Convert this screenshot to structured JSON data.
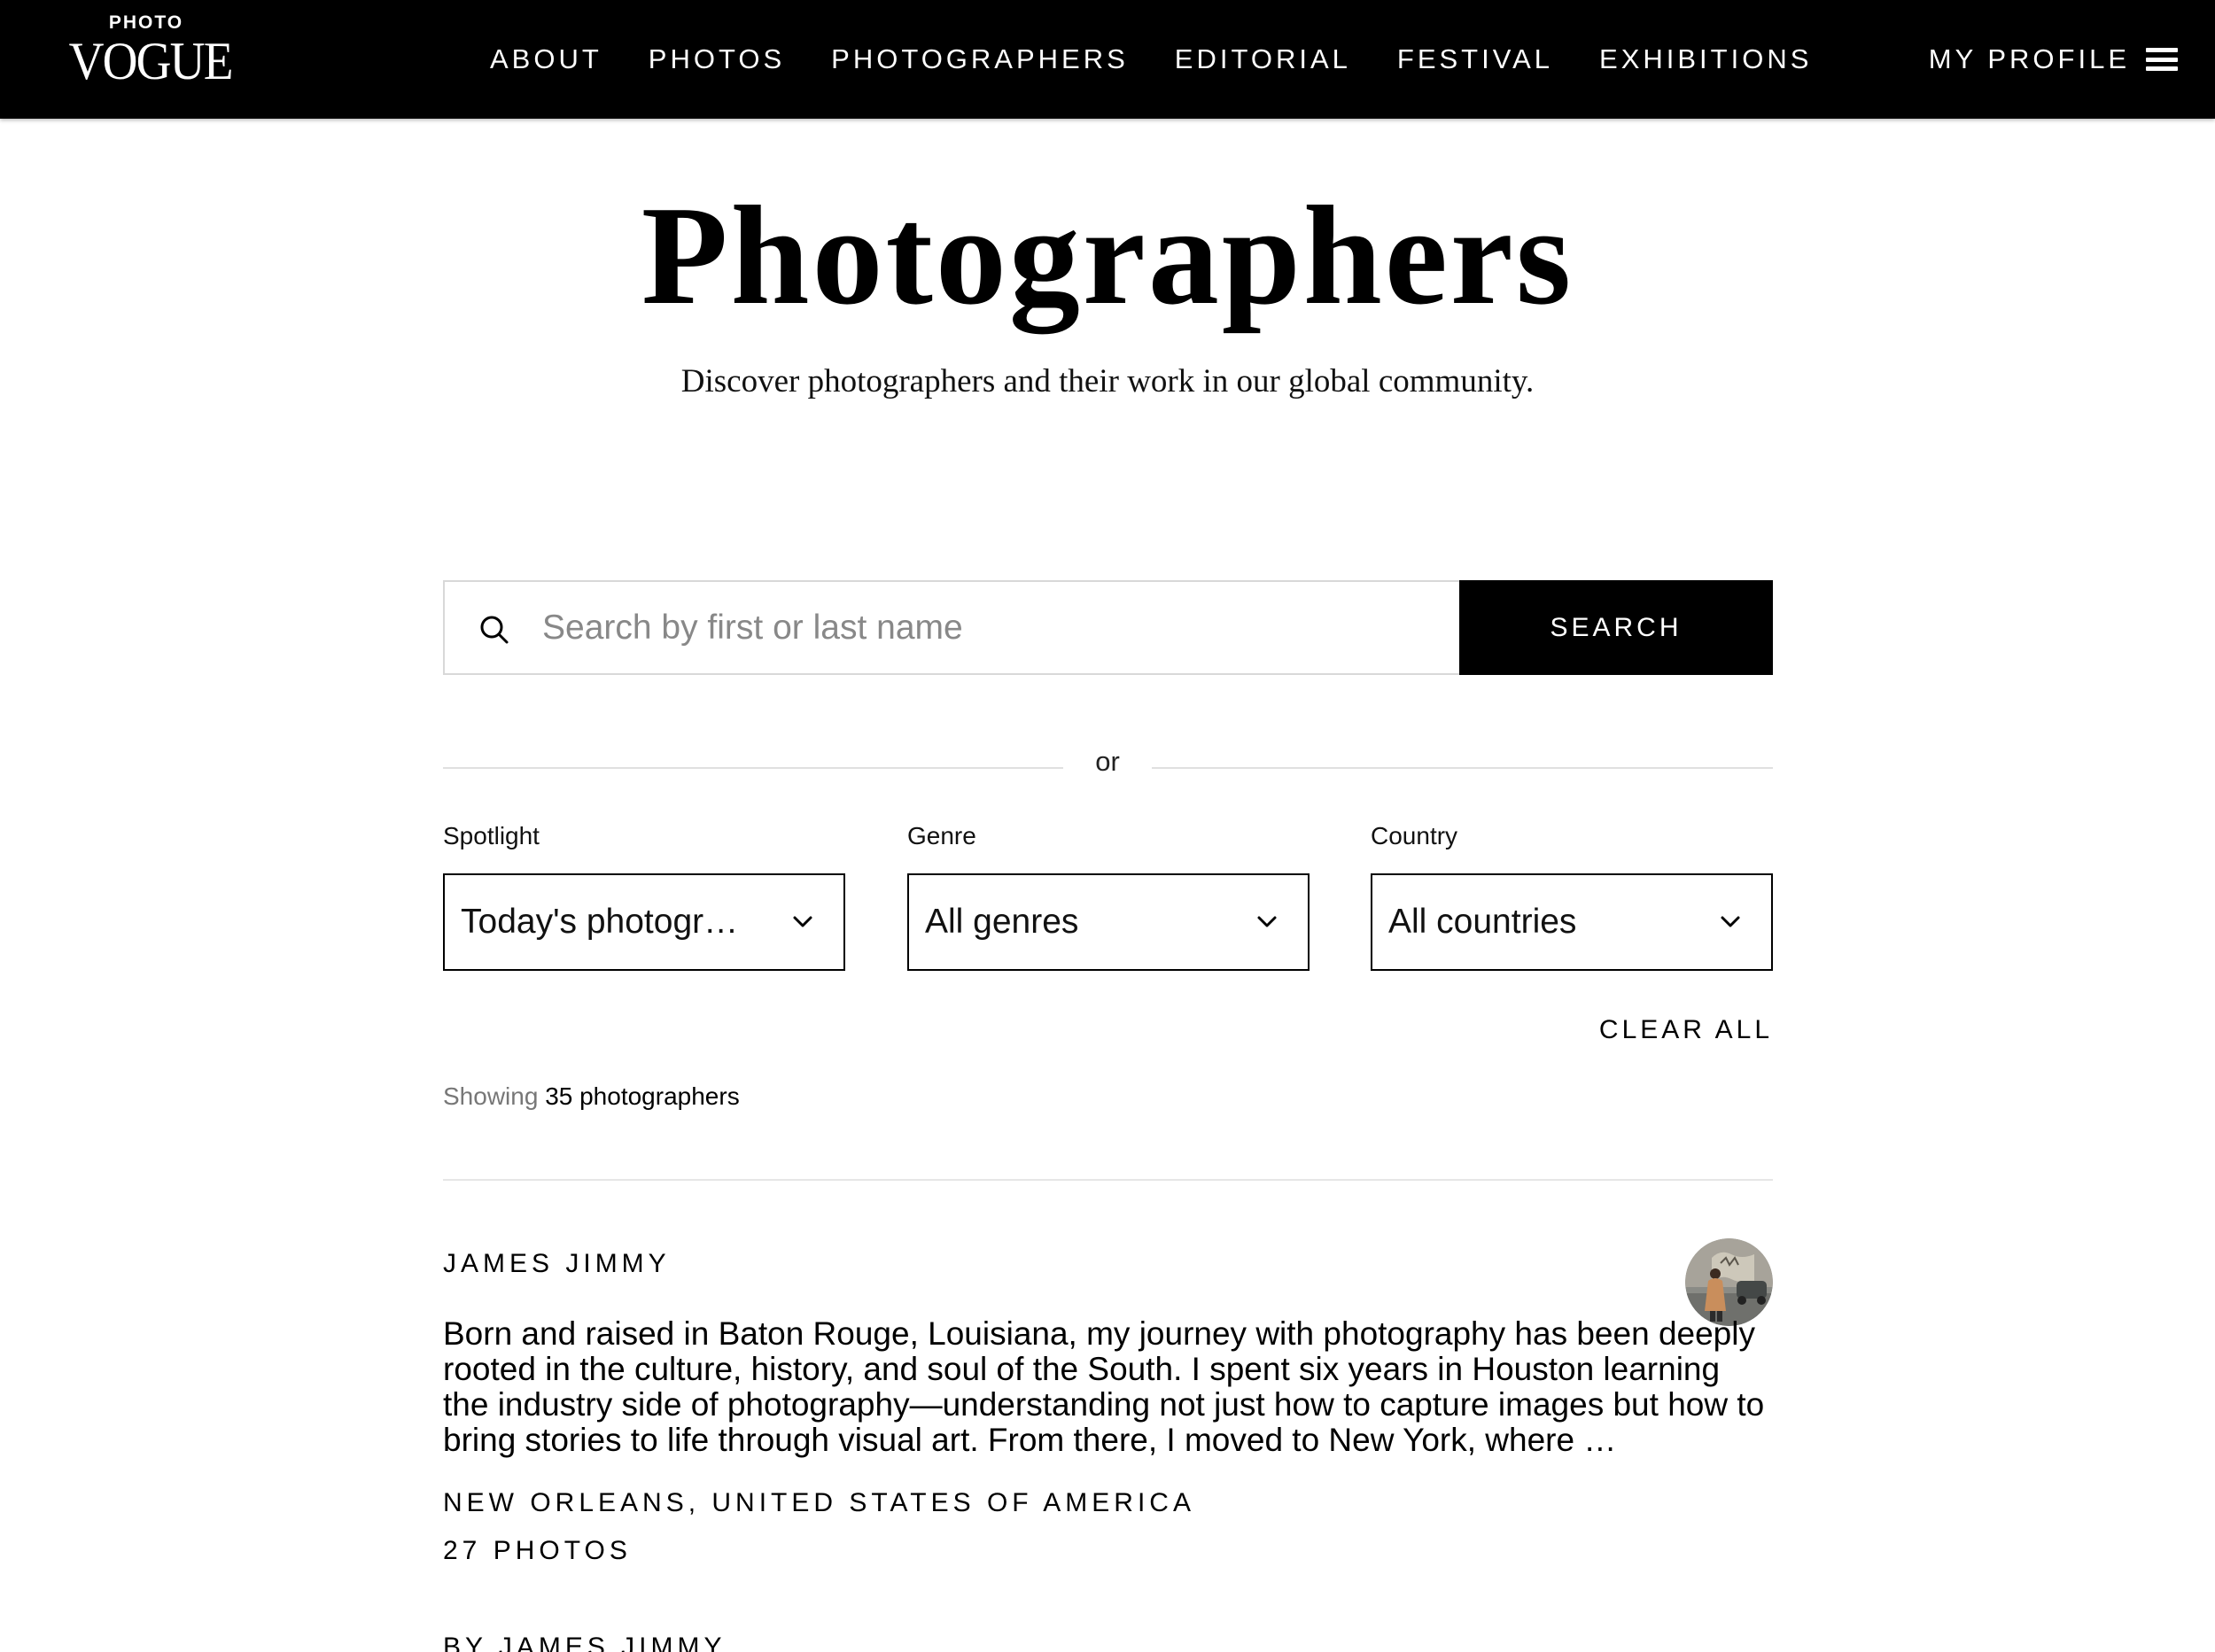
{
  "header": {
    "logo_small": "PHOTO",
    "logo_big": "VOGUE",
    "nav": [
      {
        "label": "ABOUT"
      },
      {
        "label": "PHOTOS"
      },
      {
        "label": "PHOTOGRAPHERS"
      },
      {
        "label": "EDITORIAL"
      },
      {
        "label": "FESTIVAL"
      },
      {
        "label": "EXHIBITIONS"
      }
    ],
    "profile_label": "MY PROFILE",
    "menu_icon": "hamburger-menu-icon"
  },
  "hero": {
    "title": "Photographers",
    "subtitle": "Discover photographers and their work in our global community."
  },
  "search": {
    "icon": "search-icon",
    "placeholder": "Search by first or last name",
    "value": "",
    "button_label": "SEARCH"
  },
  "divider": {
    "text": "or"
  },
  "filters": {
    "spotlight": {
      "label": "Spotlight",
      "value": "Today's photogr…"
    },
    "genre": {
      "label": "Genre",
      "value": "All genres"
    },
    "country": {
      "label": "Country",
      "value": "All countries"
    },
    "chevron_icon": "chevron-down-icon",
    "clear_all_label": "CLEAR ALL"
  },
  "results": {
    "showing_prefix": "Showing",
    "showing_count_text": "35 photographers"
  },
  "photographers": [
    {
      "name": "JAMES JIMMY",
      "bio": "Born and raised in Baton Rouge, Louisiana, my journey with photography has been deeply rooted in the culture, history, and soul of the South. I spent six years in Houston learning the industry side of photography—understanding not just how to capture images but how to bring stories to life through visual art. From there, I moved to New York, where …",
      "location": "NEW ORLEANS, UNITED STATES OF AMERICA",
      "photos": "27 PHOTOS",
      "by_line": "BY JAMES JIMMY"
    }
  ],
  "colors": {
    "nav_bg": "#000000",
    "nav_text": "#ffffff",
    "button_bg": "#000000",
    "border_light": "#d8d8d8",
    "divider": "#e0e0e0",
    "muted_text": "#777777"
  }
}
